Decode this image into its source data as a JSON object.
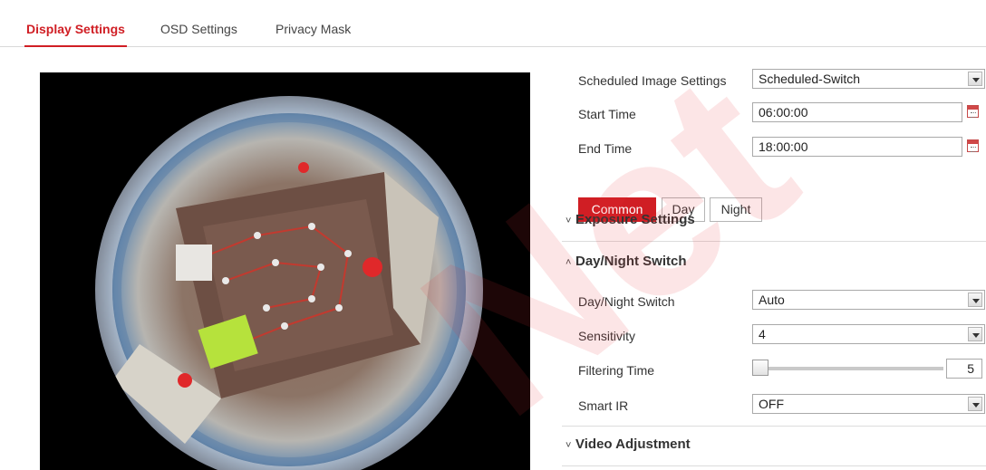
{
  "tabs": {
    "display": "Display Settings",
    "osd": "OSD Settings",
    "privacy": "Privacy Mask"
  },
  "schedule": {
    "label": "Scheduled Image Settings",
    "value": "Scheduled-Switch"
  },
  "start_time": {
    "label": "Start Time",
    "value": "06:00:00"
  },
  "end_time": {
    "label": "End Time",
    "value": "18:00:00"
  },
  "modes": {
    "common": "Common",
    "day": "Day",
    "night": "Night",
    "active": "Common"
  },
  "sections": {
    "exposure": {
      "title": "Exposure Settings",
      "expanded": false
    },
    "day_night": {
      "title": "Day/Night Switch",
      "expanded": true
    },
    "video": {
      "title": "Video Adjustment",
      "expanded": false
    }
  },
  "day_night_switch": {
    "label": "Day/Night Switch",
    "value": "Auto"
  },
  "sensitivity": {
    "label": "Sensitivity",
    "value": "4"
  },
  "filtering_time": {
    "label": "Filtering Time",
    "value": "5",
    "slider_fraction": 0.0
  },
  "smart_ir": {
    "label": "Smart IR",
    "value": "OFF"
  },
  "colors": {
    "accent": "#d01e24",
    "watermark": "#e8343a"
  },
  "icons": {
    "calendar": "calendar-icon",
    "dropdown": "chevron-down-icon",
    "collapsed": "chevron-down-icon",
    "expanded": "chevron-up-icon"
  }
}
